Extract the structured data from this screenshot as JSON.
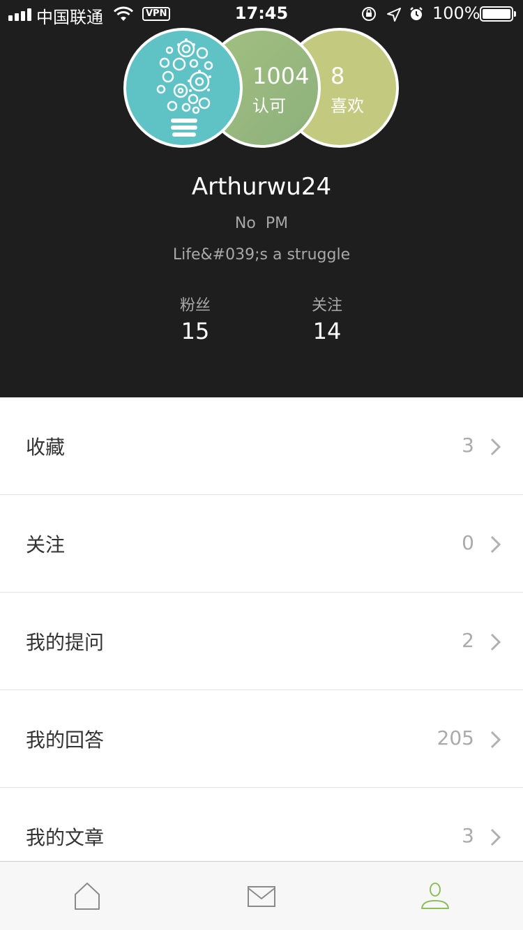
{
  "status_bar": {
    "carrier": "中国联通",
    "vpn": "VPN",
    "time": "17:45",
    "battery": "100%"
  },
  "profile": {
    "approvals_count": "1004",
    "approvals_label": "认可",
    "likes_count": "8",
    "likes_label": "喜欢",
    "username": "Arthurwu24",
    "pm_text": "No  PM",
    "bio": "Life&#039;s a struggle",
    "fans_label": "粉丝",
    "fans_count": "15",
    "following_label": "关注",
    "following_count": "14"
  },
  "menu": [
    {
      "label": "收藏",
      "count": "3"
    },
    {
      "label": "关注",
      "count": "0"
    },
    {
      "label": "我的提问",
      "count": "2"
    },
    {
      "label": "我的回答",
      "count": "205"
    },
    {
      "label": "我的文章",
      "count": "3"
    }
  ],
  "tabbar": {
    "tabs": [
      {
        "icon": "home-icon",
        "active": false
      },
      {
        "icon": "mail-icon",
        "active": false
      },
      {
        "icon": "user-icon",
        "active": true
      }
    ]
  },
  "colors": {
    "header_bg": "#1e1e1e",
    "avatar_bg": "#5fc3c6",
    "approvals_bg": "#97b87e",
    "likes_bg": "#c3c97e",
    "active_tab": "#8bbf5a"
  }
}
